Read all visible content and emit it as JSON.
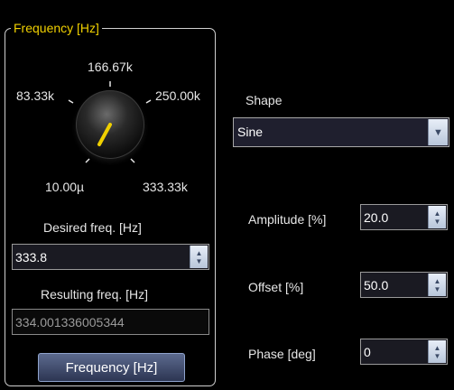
{
  "frequency_group": {
    "title": "Frequency [Hz]",
    "knob_ticks": {
      "top": "166.67k",
      "upper_left": "83.33k",
      "upper_right": "250.00k",
      "lower_left": "10.00µ",
      "lower_right": "333.33k"
    },
    "desired_label": "Desired freq. [Hz]",
    "desired_value": "333.8",
    "resulting_label": "Resulting freq. [Hz]",
    "resulting_value": "334.001336005344",
    "button_label": "Frequency [Hz]"
  },
  "shape": {
    "label": "Shape",
    "selected": "Sine"
  },
  "amplitude": {
    "label": "Amplitude [%]",
    "value": "20.0"
  },
  "offset": {
    "label": "Offset [%]",
    "value": "50.0"
  },
  "phase": {
    "label": "Phase [deg]",
    "value": "0"
  },
  "colors": {
    "background": "#000000",
    "group_title": "#f0d000",
    "knob_pointer": "#f0d000",
    "button_bg": "#3c4768"
  }
}
